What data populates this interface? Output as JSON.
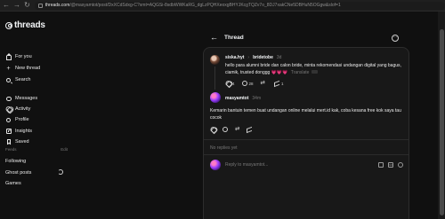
{
  "browser": {
    "nav": [
      "←",
      "→",
      "↻"
    ],
    "url_host": "threads.com",
    "url_rest": "/@masyamtot/post/DxXCdSdxg-C?xmt=AQGSi-8sdbWWKaRG_dgLzPQHXeoxgBHYJKcgTQZv7o_8DJ7xakCNe5DBHuN5OGgw&slof=1"
  },
  "sidebar": {
    "logo": "threads",
    "items": [
      {
        "label": "For you"
      },
      {
        "label": "New thread"
      },
      {
        "label": "Search"
      },
      {
        "label": "Messages"
      },
      {
        "label": "Activity"
      },
      {
        "label": "Profile"
      },
      {
        "label": "Insights"
      },
      {
        "label": "Saved"
      }
    ],
    "feeds_label": "Feeds",
    "feeds_edit": "Edit",
    "feeds": [
      {
        "label": "Following"
      },
      {
        "label": "Ghost posts"
      },
      {
        "label": "Games"
      }
    ]
  },
  "thread": {
    "title": "Thread",
    "post1": {
      "username": "siska.hyt",
      "separator": "›",
      "reply_to": "bridetobe",
      "time": "3d",
      "text": "hello para alumni bride dan calon bride, minta rekomendasi undangan digital yang bagus, ciamik, trusted donggg",
      "emoji": "💗💗💗",
      "translate": "Translate",
      "likes": "4",
      "comments": "28",
      "reposts": "",
      "shares": "1"
    },
    "post2": {
      "username": "masyamtot",
      "time": "34m",
      "text": "Kemarin bantuin temen buat undangan online melalui mert.id kak, coba kesana free kok saya tau cocok",
      "likes": "",
      "comments": "",
      "reposts": "",
      "shares": ""
    },
    "no_replies": "No replies yet",
    "reply_placeholder": "Reply to masyamtot..."
  },
  "colors": {
    "background": "#101010",
    "card": "#181818",
    "accent_heart": "#ff2f92"
  }
}
